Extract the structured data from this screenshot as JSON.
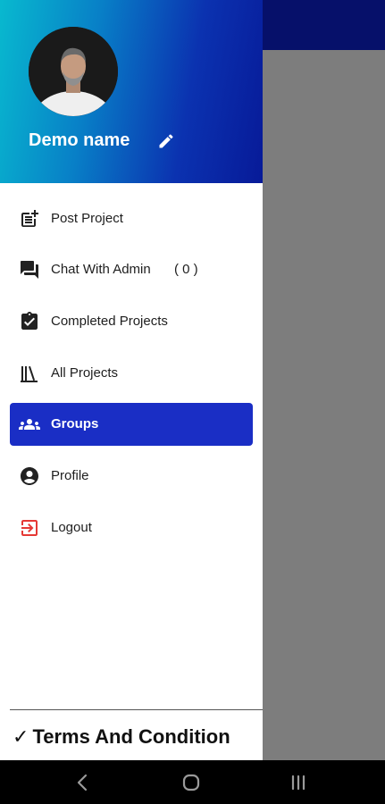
{
  "profile": {
    "name": "Demo name"
  },
  "menu": {
    "items": [
      {
        "label": "Post Project"
      },
      {
        "label": "Chat With Admin",
        "count": "( 0 )"
      },
      {
        "label": "Completed Projects"
      },
      {
        "label": "All Projects"
      },
      {
        "label": "Groups"
      },
      {
        "label": "Profile"
      },
      {
        "label": "Logout"
      }
    ],
    "active_item": "Groups"
  },
  "footer": {
    "check": "✓",
    "terms_label": "Terms And Condition"
  },
  "icons": {
    "post_project": "post-add-icon",
    "chat": "chat-bubbles-icon",
    "completed": "clipboard-check-icon",
    "all_projects": "library-books-icon",
    "groups": "groups-icon",
    "profile": "account-circle-icon",
    "logout": "logout-icon",
    "edit": "pencil-icon"
  },
  "colors": {
    "header_gradient_start": "#08b9cf",
    "header_gradient_end": "#071a98",
    "active_item": "#1a2ec5",
    "logout_icon": "#e53935",
    "topbar": "#06106a"
  }
}
